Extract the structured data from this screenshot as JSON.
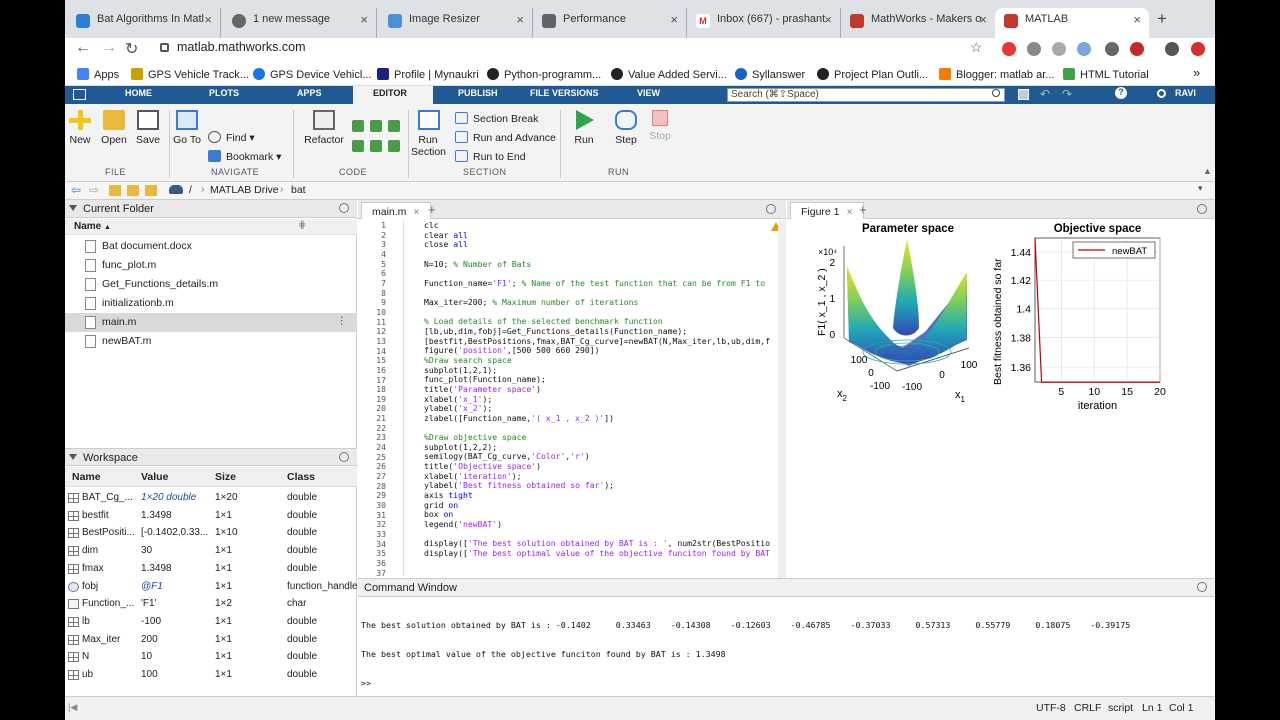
{
  "browser": {
    "tabs": [
      {
        "label": "Bat Algorithms In Matl",
        "color": "#2b7fd6"
      },
      {
        "label": "1 new message",
        "color": "#666"
      },
      {
        "label": "Image Resizer",
        "color": "#4a8fd9"
      },
      {
        "label": "Performance",
        "color": "#5f6368"
      },
      {
        "label": "Inbox (667) - prashant",
        "color": "#d93025"
      },
      {
        "label": "MathWorks - Makers o",
        "color": "#c0392b"
      },
      {
        "label": "MATLAB",
        "color": "#c0392b"
      }
    ],
    "url": "matlab.mathworks.com",
    "bookmarks": [
      "Apps",
      "GPS Vehicle Track...",
      "GPS Device Vehicl...",
      "Profile | Mynaukri",
      "Python-programm...",
      "Value Added Servi...",
      "Syllanswer",
      "Project Plan Outli...",
      "Blogger: matlab ar...",
      "HTML Tutorial"
    ],
    "more": "»"
  },
  "toolstrip": {
    "tabs": [
      "HOME",
      "PLOTS",
      "APPS",
      "EDITOR",
      "PUBLISH",
      "FILE VERSIONS",
      "VIEW"
    ],
    "search_placeholder": "Search (⌘⇧Space)",
    "user": "RAVI",
    "file": {
      "new": "New",
      "open": "Open",
      "save": "Save",
      "label": "FILE"
    },
    "navigate": {
      "goto": "Go To",
      "find": "Find",
      "bookmark": "Bookmark",
      "label": "NAVIGATE"
    },
    "code": {
      "refactor": "Refactor",
      "label": "CODE"
    },
    "section": {
      "run_section": "Run Section",
      "section_break": "Section Break",
      "run_advance": "Run and Advance",
      "run_end": "Run to End",
      "label": "SECTION"
    },
    "run": {
      "run": "Run",
      "step": "Step",
      "stop": "Stop",
      "label": "RUN"
    }
  },
  "path": {
    "root": "/",
    "drive": "MATLAB Drive",
    "folder": "bat",
    "sep": "›"
  },
  "current_folder": {
    "title": "Current Folder",
    "col": "Name",
    "sort": "▲",
    "files": [
      "Bat document.docx",
      "func_plot.m",
      "Get_Functions_details.m",
      "initializationb.m",
      "main.m",
      "newBAT.m"
    ],
    "selected": 4,
    "row_menu": "⋮"
  },
  "workspace": {
    "title": "Workspace",
    "cols": [
      "Name",
      "Value",
      "Size",
      "Class"
    ],
    "rows": [
      {
        "name": "BAT_Cg_...",
        "value": "1×20 double",
        "size": "1×20",
        "cls": "double"
      },
      {
        "name": "bestfit",
        "value": "1.3498",
        "size": "1×1",
        "cls": "double"
      },
      {
        "name": "BestPositi...",
        "value": "[-0.1402,0.33...",
        "size": "1×10",
        "cls": "double"
      },
      {
        "name": "dim",
        "value": "30",
        "size": "1×1",
        "cls": "double"
      },
      {
        "name": "fmax",
        "value": "1.3498",
        "size": "1×1",
        "cls": "double"
      },
      {
        "name": "fobj",
        "value": "@F1",
        "size": "1×1",
        "cls": "function_handle"
      },
      {
        "name": "Function_...",
        "value": "'F1'",
        "size": "1×2",
        "cls": "char"
      },
      {
        "name": "lb",
        "value": "-100",
        "size": "1×1",
        "cls": "double"
      },
      {
        "name": "Max_iter",
        "value": "200",
        "size": "1×1",
        "cls": "double"
      },
      {
        "name": "N",
        "value": "10",
        "size": "1×1",
        "cls": "double"
      },
      {
        "name": "ub",
        "value": "100",
        "size": "1×1",
        "cls": "double"
      }
    ]
  },
  "editor": {
    "tab": "main.m",
    "close": "×",
    "add": "+",
    "lines": [
      [
        [
          "",
          "clc"
        ]
      ],
      [
        [
          "",
          "clear "
        ],
        [
          "kw",
          "all"
        ]
      ],
      [
        [
          "",
          "close "
        ],
        [
          "kw",
          "all"
        ]
      ],
      [],
      [
        [
          "",
          "N=10; "
        ],
        [
          "cm",
          "% Number of Bats"
        ]
      ],
      [],
      [
        [
          "",
          "Function_name="
        ],
        [
          "str",
          "'F1'"
        ],
        [
          "",
          "; "
        ],
        [
          "cm",
          "% Name of the test function that can be from F1 to"
        ]
      ],
      [],
      [
        [
          "",
          "Max_iter=200; "
        ],
        [
          "cm",
          "% Maximum number of iterations"
        ]
      ],
      [],
      [
        [
          "cm",
          "% Load details of the selected benchmark function"
        ]
      ],
      [
        [
          "",
          "[lb,ub,dim,fobj]=Get_Functions_details(Function_name);"
        ]
      ],
      [
        [
          "",
          "[bestfit,BestPositions,fmax,BAT_Cg_curve]=newBAT(N,Max_iter,lb,ub,dim,f"
        ]
      ],
      [
        [
          "",
          "figure("
        ],
        [
          "str",
          "'position'"
        ],
        [
          "",
          ",[500 500 660 290])"
        ]
      ],
      [
        [
          "cm",
          "%Draw search space"
        ]
      ],
      [
        [
          "",
          "subplot(1,2,1);"
        ]
      ],
      [
        [
          "",
          "func_plot(Function_name);"
        ]
      ],
      [
        [
          "",
          "title("
        ],
        [
          "str",
          "'Parameter space'"
        ],
        [
          "",
          ")"
        ]
      ],
      [
        [
          "",
          "xlabel("
        ],
        [
          "str",
          "'x_1'"
        ],
        [
          "",
          ");"
        ]
      ],
      [
        [
          "",
          "ylabel("
        ],
        [
          "str",
          "'x_2'"
        ],
        [
          "",
          ");"
        ]
      ],
      [
        [
          "",
          "zlabel([Function_name,"
        ],
        [
          "str",
          "'( x_1 , x_2 )'"
        ],
        [
          "",
          "])"
        ]
      ],
      [],
      [
        [
          "cm",
          "%Draw objective space"
        ]
      ],
      [
        [
          "",
          "subplot(1,2,2);"
        ]
      ],
      [
        [
          "",
          "semilogy(BAT_Cg_curve,"
        ],
        [
          "str",
          "'Color'"
        ],
        [
          "",
          ","
        ],
        [
          "str",
          "'r'"
        ],
        [
          "",
          ")"
        ]
      ],
      [
        [
          "",
          "title("
        ],
        [
          "str",
          "'Objective space'"
        ],
        [
          "",
          ")"
        ]
      ],
      [
        [
          "",
          "xlabel("
        ],
        [
          "str",
          "'iteration'"
        ],
        [
          "",
          ");"
        ]
      ],
      [
        [
          "",
          "ylabel("
        ],
        [
          "str",
          "'Best fitness obtained so far'"
        ],
        [
          "",
          ");"
        ]
      ],
      [
        [
          "",
          "axis "
        ],
        [
          "kw",
          "tight"
        ]
      ],
      [
        [
          "",
          "grid "
        ],
        [
          "kw",
          "on"
        ]
      ],
      [
        [
          "",
          "box "
        ],
        [
          "kw",
          "on"
        ]
      ],
      [
        [
          "",
          "legend("
        ],
        [
          "str",
          "'newBAT'"
        ],
        [
          "",
          ")"
        ]
      ],
      [],
      [
        [
          "",
          "display(["
        ],
        [
          "str",
          "'The best solution obtained by BAT is : '"
        ],
        [
          "",
          ", num2str(BestPositio"
        ]
      ],
      [
        [
          "",
          "display(["
        ],
        [
          "str",
          "'The best optimal value of the objective funciton found by BAT"
        ]
      ],
      [],
      []
    ]
  },
  "figure": {
    "tab": "Figure 1",
    "left_title": "Parameter space",
    "zlabel": "F1( x_1 , x_2 )",
    "z_exp": "×10⁴",
    "zticks": [
      "2",
      "1",
      "0"
    ],
    "x1_ticks": [
      "-100",
      "0",
      "100"
    ],
    "x2_ticks": [
      "-100",
      "0",
      "100"
    ],
    "x1": "x",
    "x1_sub": "1",
    "x2": "x",
    "x2_sub": "2",
    "right_title": "Objective space",
    "ylabel": "Best fitness obtained so far",
    "xlabel": "iteration",
    "legend": "newBAT",
    "series_color": "#c00000"
  },
  "chart_data": {
    "type": "line",
    "title": "Objective space",
    "xlabel": "iteration",
    "ylabel": "Best fitness obtained so far",
    "yscale": "log",
    "xlim": [
      1,
      20
    ],
    "ylim": [
      1.35,
      1.45
    ],
    "xticks": [
      5,
      10,
      15,
      20
    ],
    "yticks": [
      1.36,
      1.38,
      1.4,
      1.42,
      1.44
    ],
    "grid": "on",
    "legend": "top-right",
    "series": [
      {
        "name": "newBAT",
        "x": [
          1,
          2,
          3,
          4,
          5,
          6,
          7,
          8,
          9,
          10,
          11,
          12,
          13,
          14,
          15,
          16,
          17,
          18,
          19,
          20
        ],
        "values": [
          1.45,
          1.3498,
          1.3498,
          1.3498,
          1.3498,
          1.3498,
          1.3498,
          1.3498,
          1.3498,
          1.3498,
          1.3498,
          1.3498,
          1.3498,
          1.3498,
          1.3498,
          1.3498,
          1.3498,
          1.3498,
          1.3498,
          1.3498
        ]
      }
    ]
  },
  "command_window": {
    "title": "Command Window",
    "lines": [
      "The best solution obtained by BAT is : -0.1402     0.33463    -0.14308    -0.12603    -0.46785    -0.37033     0.57313     0.55779     0.18075    -0.39175",
      "The best optimal value of the objective funciton found by BAT is : 1.3498",
      ">>"
    ]
  },
  "status": {
    "encoding": "UTF-8",
    "eol": "CRLF",
    "type": "script",
    "ln": "Ln 1",
    "col": "Col 1"
  }
}
